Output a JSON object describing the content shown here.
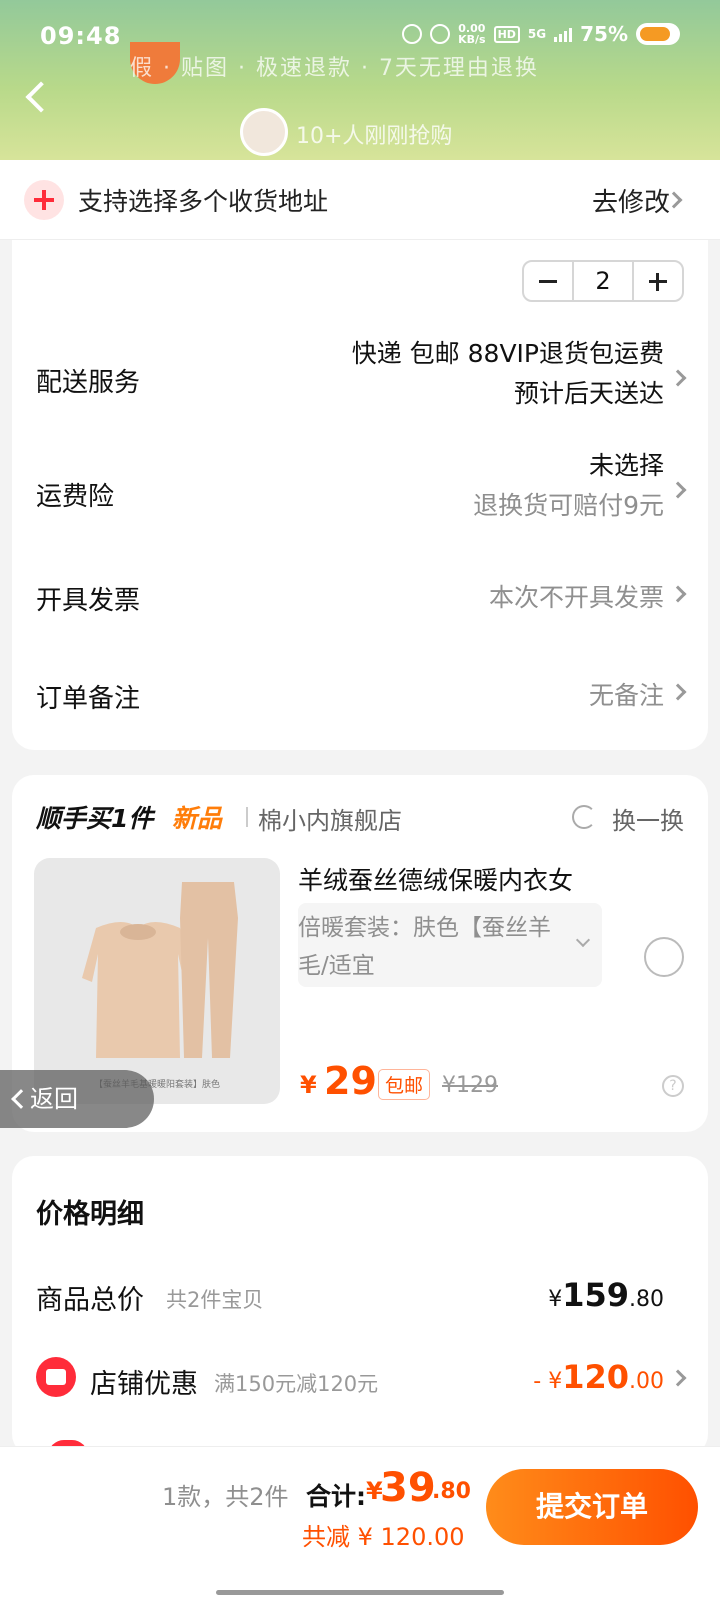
{
  "status_bar": {
    "time": "09:48",
    "net_speed": "0.00",
    "net_unit": "KB/s",
    "hd": "HD",
    "signal": "5G",
    "battery": "75%"
  },
  "header": {
    "banner_text_1": "假 · 贴图 · 极速退款 · 7天无理由退换",
    "banner_text_2": "10+人刚刚抢购"
  },
  "address_tip": {
    "text": "支持选择多个收货地址",
    "action": "去修改"
  },
  "order": {
    "quantity": "2",
    "delivery": {
      "label": "配送服务",
      "value": "快递 包邮 88VIP退货包运费",
      "sub": "预计后天送达"
    },
    "freight_insurance": {
      "label": "运费险",
      "value": "未选择",
      "sub": "退换货可赔付9元"
    },
    "invoice": {
      "label": "开具发票",
      "value": "本次不开具发票"
    },
    "remark": {
      "label": "订单备注",
      "value": "无备注"
    }
  },
  "addon": {
    "title": "顺手买1件",
    "badge": "新品",
    "shop": "棉小内旗舰店",
    "swap_label": "换一换",
    "product_name": "羊绒蚕丝德绒保暖内衣女",
    "variant": "倍暖套装：肤色【蚕丝羊毛/适宜",
    "image_caption": "【蚕丝羊毛基暖暖阳套装】肤色",
    "currency": "¥",
    "price": "29",
    "tag": "包邮",
    "original_price": "¥129"
  },
  "back_button": {
    "label": "返回"
  },
  "price_detail": {
    "title": "价格明细",
    "subtotal_label": "商品总价",
    "subtotal_hint": "共2件宝贝",
    "subtotal_currency": "¥",
    "subtotal_int": "159",
    "subtotal_dec": ".80",
    "discount_label": "店铺优惠",
    "discount_hint": "满150元减120元",
    "discount_prefix": "- ¥",
    "discount_int": "120",
    "discount_dec": ".00"
  },
  "bottom_bar": {
    "count": "1款，共2件",
    "total_label": "合计:",
    "total_currency": "¥",
    "total_int": "39",
    "total_dec": ".80",
    "saved": "共减 ¥ 120.00",
    "submit": "提交订单"
  },
  "colors": {
    "accent": "#ff5000",
    "accent_gradient_start": "#ff8c1a",
    "badge_red": "#ff2c3a",
    "new_orange": "#ff7d0a"
  }
}
